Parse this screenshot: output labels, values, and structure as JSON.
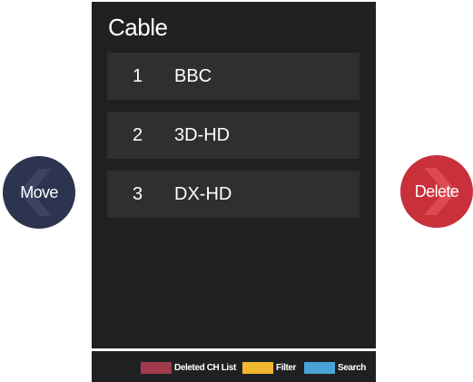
{
  "panel": {
    "title": "Cable",
    "channels": [
      {
        "number": "1",
        "name": "BBC"
      },
      {
        "number": "2",
        "name": "3D-HD"
      },
      {
        "number": "3",
        "name": "DX-HD"
      }
    ]
  },
  "buttons": {
    "move_label": "Move",
    "delete_label": "Delete",
    "move_icon": "chevron-left-icon",
    "delete_icon": "chevron-right-icon"
  },
  "footer": {
    "legend": [
      {
        "label": "Deleted CH List",
        "color": "#a03a4c"
      },
      {
        "label": "Filter",
        "color": "#f2b731"
      },
      {
        "label": "Search",
        "color": "#4aa3d6"
      }
    ]
  },
  "colors": {
    "panel_bg": "#1f2022",
    "row_bg": "#2e2f31",
    "move_bg": "#2d3450",
    "delete_bg": "#c8303a"
  }
}
